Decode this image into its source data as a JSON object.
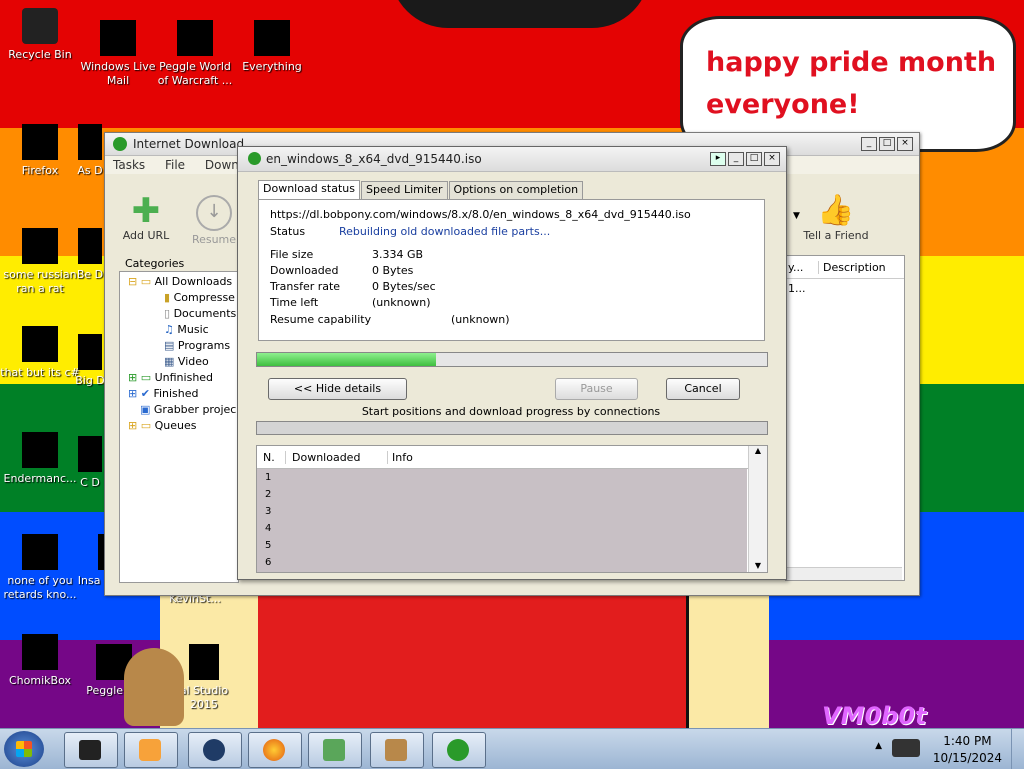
{
  "desktop": {
    "speech": {
      "line1": "happy pride month",
      "line2": "everyone!"
    },
    "watermark": "VM0b0t",
    "icons": [
      {
        "label": "Recycle Bin"
      },
      {
        "label": "Windows Live Mail"
      },
      {
        "label": "Peggle World of Warcraft ..."
      },
      {
        "label": "Everything"
      },
      {
        "label": "Firefox"
      },
      {
        "label": "As D"
      },
      {
        "label": "some russian ran a rat"
      },
      {
        "label": "Be D"
      },
      {
        "label": "that but its c#"
      },
      {
        "label": "Big D"
      },
      {
        "label": "Endermanc..."
      },
      {
        "label": "C D"
      },
      {
        "label": "none of you retards kno..."
      },
      {
        "label": "Insa Deluxe"
      },
      {
        "label": "KevinSt..."
      },
      {
        "label": "ChomikBox"
      },
      {
        "label": "Peggle De"
      },
      {
        "label": "al Studio 2015"
      }
    ]
  },
  "idm_main": {
    "title": "Internet Download",
    "menu": [
      "Tasks",
      "File",
      "Downlo"
    ],
    "toolbar": {
      "add_url": "Add URL",
      "resume": "Resume",
      "tell_friend": "Tell a Friend"
    },
    "categories_label": "Categories",
    "tree": [
      {
        "label": "All Downloads",
        "indent": 1
      },
      {
        "label": "Compresse",
        "indent": 2
      },
      {
        "label": "Documents",
        "indent": 2
      },
      {
        "label": "Music",
        "indent": 2
      },
      {
        "label": "Programs",
        "indent": 2
      },
      {
        "label": "Video",
        "indent": 2
      },
      {
        "label": "Unfinished",
        "indent": 1
      },
      {
        "label": "Finished",
        "indent": 1
      },
      {
        "label": "Grabber projec",
        "indent": 1
      },
      {
        "label": "Queues",
        "indent": 1
      }
    ],
    "list_headers": {
      "col_a": "y...",
      "description": "Description"
    },
    "list_row": {
      "col_a": "1..."
    }
  },
  "dialog": {
    "title": "en_windows_8_x64_dvd_915440.iso",
    "tabs": [
      "Download status",
      "Speed Limiter",
      "Options on completion"
    ],
    "url": "https://dl.bobpony.com/windows/8.x/8.0/en_windows_8_x64_dvd_915440.iso",
    "status_label": "Status",
    "status_value": "Rebuilding old downloaded file parts...",
    "file_size_label": "File size",
    "file_size_value": "3.334  GB",
    "downloaded_label": "Downloaded",
    "downloaded_value": "0 Bytes",
    "transfer_rate_label": "Transfer rate",
    "transfer_rate_value": "0  Bytes/sec",
    "time_left_label": "Time left",
    "time_left_value": "(unknown)",
    "resume_label": "Resume capability",
    "resume_value": "(unknown)",
    "progress_fraction": 0.35,
    "hide_details": "<< Hide details",
    "pause": "Pause",
    "cancel": "Cancel",
    "connections_caption": "Start positions and download progress by connections",
    "conn_headers": {
      "n": "N.",
      "downloaded": "Downloaded",
      "info": "Info"
    },
    "conn_rows": [
      "1",
      "2",
      "3",
      "4",
      "5",
      "6"
    ]
  },
  "taskbar": {
    "time": "1:40 PM",
    "date": "10/15/2024"
  },
  "colors": {
    "stripes": [
      "#e40303",
      "#ff8c00",
      "#ffed00",
      "#008026",
      "#004dff",
      "#750787"
    ],
    "speech_text": "#e01020",
    "progress": "#3fbf3f"
  }
}
